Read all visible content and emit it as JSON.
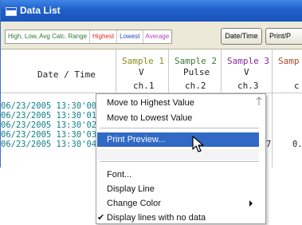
{
  "window": {
    "title": "Data List"
  },
  "toolbar": {
    "legend": {
      "range": "High, Low, Avg Calc. Range",
      "highest": "Highest",
      "lowest": "Lowest",
      "average": "Average"
    },
    "date_time_button": "Date/Time",
    "print_button": "Print/P"
  },
  "table": {
    "date_time_header": "Date / Time",
    "columns": [
      {
        "name": "Sample 1",
        "unit": "V",
        "channel": "ch.1",
        "color": "#8a8a1a"
      },
      {
        "name": "Sample 2",
        "unit": "Pulse",
        "channel": "ch.2",
        "color": "#3c7a3c"
      },
      {
        "name": "Sample 3",
        "unit": "V",
        "channel": "ch.3",
        "color": "#8a2a9a"
      },
      {
        "name": "Samp",
        "unit": "",
        "channel": "c",
        "color": "#a04a2a"
      }
    ],
    "rows": [
      {
        "timestamp": "06/23/2005 13:30'00"
      },
      {
        "timestamp": "06/23/2005 13:30'01"
      },
      {
        "timestamp": "06/23/2005 13:30'02"
      },
      {
        "timestamp": "06/23/2005 13:30'03"
      },
      {
        "timestamp": "06/23/2005 13:30'04"
      }
    ],
    "visible_values": [
      "7",
      "0."
    ]
  },
  "context_menu": {
    "items": [
      {
        "label": "Move to Highest Value",
        "selected": false
      },
      {
        "label": "Move to Lowest Value",
        "selected": false
      },
      {
        "label": "Print Preview...",
        "selected": true
      },
      {
        "label": "Font...",
        "selected": false
      },
      {
        "label": "Display Line",
        "selected": false
      },
      {
        "label": "Change Color",
        "selected": false,
        "submenu": true
      },
      {
        "label": "Display lines with no data",
        "selected": false,
        "checked": true
      }
    ],
    "check_glyph": "✔"
  },
  "colors": {
    "titlebar": "#1f5fc9",
    "selection": "#316ac5",
    "timestamp_text": "#12808a"
  }
}
